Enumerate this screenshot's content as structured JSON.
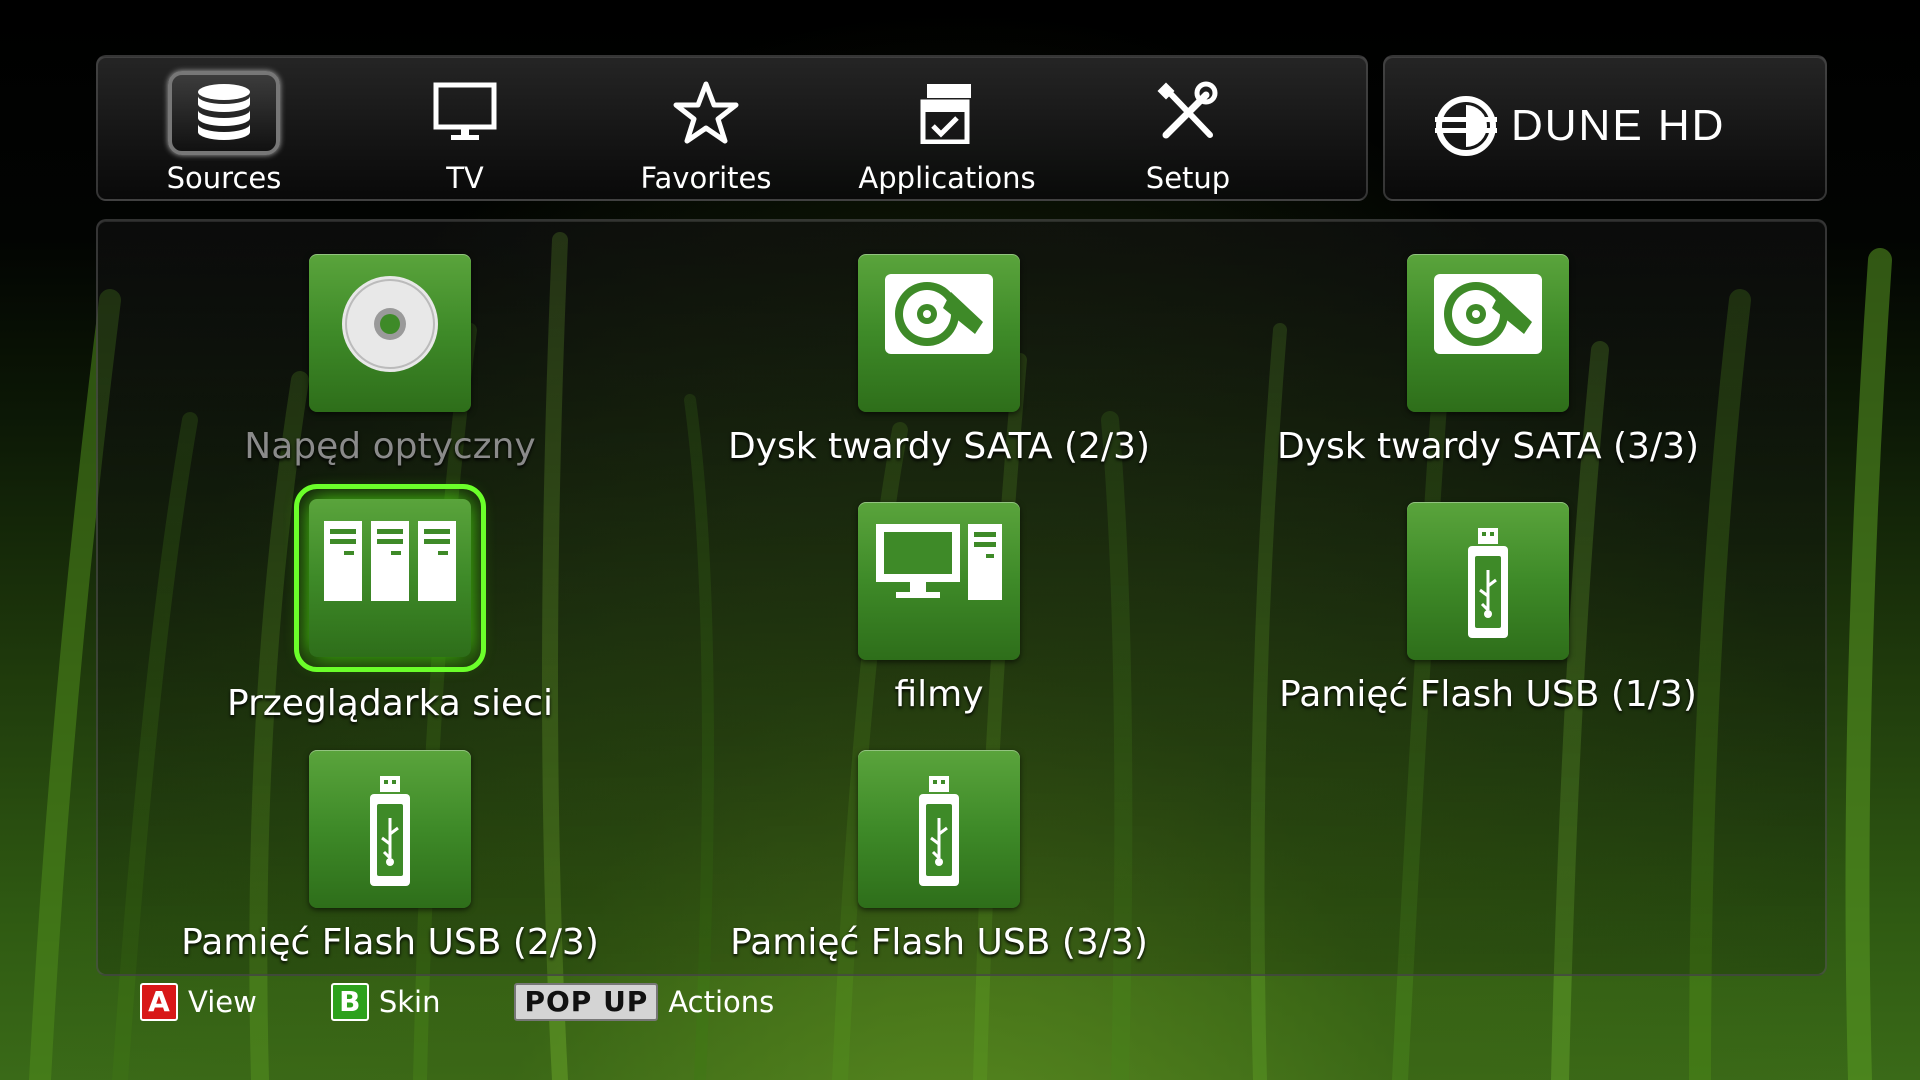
{
  "nav": {
    "items": [
      {
        "label": "Sources",
        "icon": "database-icon",
        "selected": true
      },
      {
        "label": "TV",
        "icon": "monitor-icon"
      },
      {
        "label": "Favorites",
        "icon": "star-icon"
      },
      {
        "label": "Applications",
        "icon": "applications-icon"
      },
      {
        "label": "Setup",
        "icon": "tools-icon"
      }
    ]
  },
  "brand": {
    "name": "DUNE HD"
  },
  "sources": {
    "items": [
      {
        "label": "Napęd optyczny",
        "icon": "optical-disc-icon",
        "disabled": true
      },
      {
        "label": "Dysk twardy SATA (2/3)",
        "icon": "hard-drive-icon"
      },
      {
        "label": "Dysk twardy SATA (3/3)",
        "icon": "hard-drive-icon"
      },
      {
        "label": "Przeglądarka sieci",
        "icon": "network-servers-icon",
        "selected": true
      },
      {
        "label": "filmy",
        "icon": "computer-icon"
      },
      {
        "label": "Pamięć Flash USB (1/3)",
        "icon": "usb-flash-icon"
      },
      {
        "label": "Pamięć Flash USB (2/3)",
        "icon": "usb-flash-icon"
      },
      {
        "label": "Pamięć Flash USB (3/3)",
        "icon": "usb-flash-icon"
      }
    ]
  },
  "hints": [
    {
      "key": "A",
      "label": "View",
      "key_color": "#d81818"
    },
    {
      "key": "B",
      "label": "Skin",
      "key_color": "#2da11d"
    },
    {
      "key": "POP UP",
      "label": "Actions",
      "key_color": "#d4d4d4"
    }
  ],
  "colors": {
    "accent": "#6bff2a",
    "tile_green": "#3e8a28"
  }
}
